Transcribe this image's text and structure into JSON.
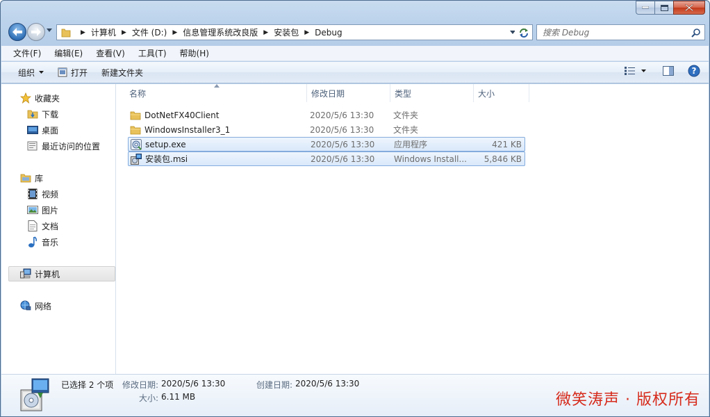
{
  "window": {
    "caption_buttons": [
      "minimize-icon",
      "maximize-icon",
      "close-icon"
    ]
  },
  "address": {
    "crumbs": [
      "计算机",
      "文件 (D:)",
      "信息管理系统改良版",
      "安装包",
      "Debug"
    ]
  },
  "search": {
    "placeholder": "搜索 Debug"
  },
  "menu": [
    "文件(F)",
    "编辑(E)",
    "查看(V)",
    "工具(T)",
    "帮助(H)"
  ],
  "toolbar": {
    "organize": "组织",
    "open": "打开",
    "new_folder": "新建文件夹"
  },
  "sidebar": {
    "favorites": {
      "label": "收藏夹",
      "items": [
        "下载",
        "桌面",
        "最近访问的位置"
      ]
    },
    "libraries": {
      "label": "库",
      "items": [
        "视频",
        "图片",
        "文档",
        "音乐"
      ]
    },
    "computer": "计算机",
    "network": "网络"
  },
  "columns": [
    "名称",
    "修改日期",
    "类型",
    "大小"
  ],
  "files": [
    {
      "name": "DotNetFX40Client",
      "date": "2020/5/6 13:30",
      "type": "文件夹",
      "size": "",
      "icon": "folder-icon",
      "selected": false
    },
    {
      "name": "WindowsInstaller3_1",
      "date": "2020/5/6 13:30",
      "type": "文件夹",
      "size": "",
      "icon": "folder-icon",
      "selected": false
    },
    {
      "name": "setup.exe",
      "date": "2020/5/6 13:30",
      "type": "应用程序",
      "size": "421 KB",
      "icon": "setup-exe-icon",
      "selected": true
    },
    {
      "name": "安装包.msi",
      "date": "2020/5/6 13:30",
      "type": "Windows Install...",
      "size": "5,846 KB",
      "icon": "msi-icon",
      "selected": true
    }
  ],
  "details": {
    "selection": "已选择 2 个项",
    "modified_label": "修改日期:",
    "modified_value": "2020/5/6 13:30",
    "created_label": "创建日期:",
    "created_value": "2020/5/6 13:30",
    "size_label": "大小:",
    "size_value": "6.11 MB"
  },
  "watermark": "微笑涛声 · 版权所有",
  "colors": {
    "selection_border": "#84acdd",
    "selection_fill": "#d9e8fa",
    "frame": "#bcd3ec",
    "watermark": "#d62b1c"
  }
}
